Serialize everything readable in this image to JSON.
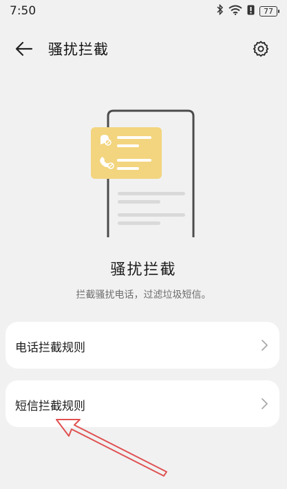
{
  "status_bar": {
    "time": "7:50",
    "battery_level": "77",
    "icons": [
      "bluetooth-icon",
      "wifi-icon",
      "alert-icon",
      "battery-icon"
    ]
  },
  "header": {
    "title": "骚扰拦截",
    "back_icon": "arrow-left-icon",
    "settings_icon": "gear-icon"
  },
  "hero": {
    "title": "骚扰拦截",
    "subtitle": "拦截骚扰电话，过滤垃圾短信。"
  },
  "list": [
    {
      "label": "电话拦截规则",
      "icon": "chevron-right-icon"
    },
    {
      "label": "短信拦截规则",
      "icon": "chevron-right-icon"
    }
  ],
  "colors": {
    "background": "#f1f1f1",
    "card": "#ffffff",
    "illustration_accent": "#f3d57f",
    "annotation_arrow": "#e05050"
  }
}
